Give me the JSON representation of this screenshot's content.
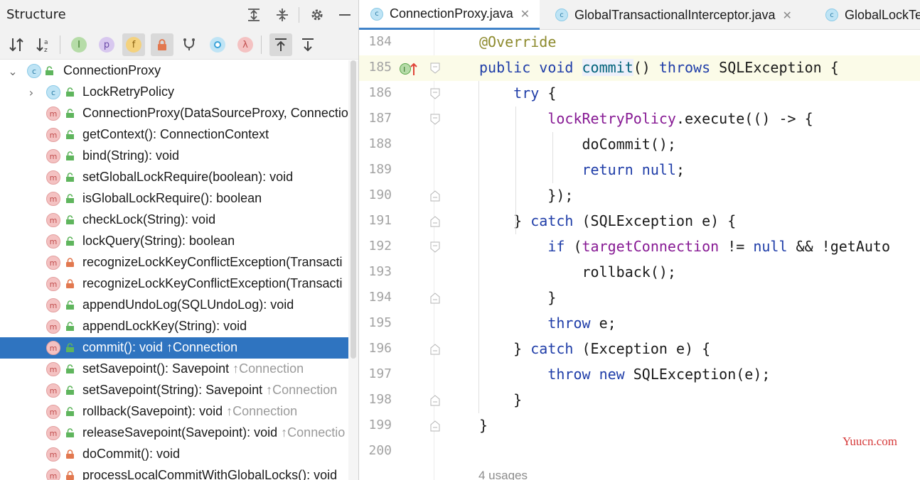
{
  "structure": {
    "title": "Structure",
    "header_icons": [
      "expand-all-icon",
      "collapse-all-icon",
      "gear-icon",
      "minimize-icon"
    ],
    "toolbar": [
      "sort-by-visibility-icon",
      "sort-alphabetically-icon",
      "show-inherited-icon",
      "show-properties-icon",
      "show-fields-icon",
      "show-non-public-icon",
      "show-anonymous-icon",
      "show-lambdas-icon",
      "show-lambda-icon",
      "autoscroll-to-source-icon",
      "autoscroll-from-source-icon"
    ],
    "root": "ConnectionProxy",
    "items": [
      {
        "kind": "c",
        "vis": "public",
        "label": "LockRetryPolicy",
        "suffix": "",
        "expandable": true
      },
      {
        "kind": "m",
        "vis": "public",
        "label": "ConnectionProxy(DataSourceProxy, Connection",
        "suffix": ""
      },
      {
        "kind": "m",
        "vis": "public",
        "label": "getContext(): ConnectionContext",
        "suffix": ""
      },
      {
        "kind": "m",
        "vis": "public",
        "label": "bind(String): void",
        "suffix": ""
      },
      {
        "kind": "m",
        "vis": "public",
        "label": "setGlobalLockRequire(boolean): void",
        "suffix": ""
      },
      {
        "kind": "m",
        "vis": "public",
        "label": "isGlobalLockRequire(): boolean",
        "suffix": ""
      },
      {
        "kind": "m",
        "vis": "public",
        "label": "checkLock(String): void",
        "suffix": ""
      },
      {
        "kind": "m",
        "vis": "public",
        "label": "lockQuery(String): boolean",
        "suffix": ""
      },
      {
        "kind": "m",
        "vis": "private",
        "label": "recognizeLockKeyConflictException(Transacti",
        "suffix": ""
      },
      {
        "kind": "m",
        "vis": "private",
        "label": "recognizeLockKeyConflictException(Transacti",
        "suffix": ""
      },
      {
        "kind": "m",
        "vis": "public",
        "label": "appendUndoLog(SQLUndoLog): void",
        "suffix": ""
      },
      {
        "kind": "m",
        "vis": "public",
        "label": "appendLockKey(String): void",
        "suffix": ""
      },
      {
        "kind": "m",
        "vis": "public",
        "label": "commit(): void ",
        "suffix": "↑Connection",
        "selected": true
      },
      {
        "kind": "m",
        "vis": "public",
        "label": "setSavepoint(): Savepoint ",
        "suffix": "↑Connection"
      },
      {
        "kind": "m",
        "vis": "public",
        "label": "setSavepoint(String): Savepoint ",
        "suffix": "↑Connection"
      },
      {
        "kind": "m",
        "vis": "public",
        "label": "rollback(Savepoint): void ",
        "suffix": "↑Connection"
      },
      {
        "kind": "m",
        "vis": "public",
        "label": "releaseSavepoint(Savepoint): void ",
        "suffix": "↑Connectio"
      },
      {
        "kind": "m",
        "vis": "private",
        "label": "doCommit(): void",
        "suffix": ""
      },
      {
        "kind": "m",
        "vis": "private",
        "label": "processLocalCommitWithGlobalLocks(): void",
        "suffix": ""
      }
    ]
  },
  "editor": {
    "tabs": [
      {
        "label": "ConnectionProxy.java",
        "active": true,
        "closable": true
      },
      {
        "label": "GlobalTransactionalInterceptor.java",
        "active": false,
        "closable": true
      },
      {
        "label": "GlobalLockTe",
        "active": false,
        "closable": false
      }
    ],
    "lines": [
      {
        "n": "184",
        "html": "<span class=\"ann\">@Override</span>"
      },
      {
        "n": "185",
        "current": true,
        "marker": true,
        "html": "<span class=\"kw\">public void</span> <span class=\"mdef\">commit</span>() <span class=\"kw\">throws</span> SQLException {"
      },
      {
        "n": "186",
        "html": "    <span class=\"kw\">try</span> {"
      },
      {
        "n": "187",
        "html": "        <span class=\"fld\">lockRetryPolicy</span>.execute(() -> {"
      },
      {
        "n": "188",
        "html": "            doCommit();"
      },
      {
        "n": "189",
        "html": "            <span class=\"kw\">return null</span>;"
      },
      {
        "n": "190",
        "html": "        });"
      },
      {
        "n": "191",
        "html": "    } <span class=\"kw\">catch</span> (SQLException e) {"
      },
      {
        "n": "192",
        "html": "        <span class=\"kw\">if</span> (<span class=\"fld\">targetConnection</span> != <span class=\"kw\">null</span> && !getAuto"
      },
      {
        "n": "193",
        "html": "            rollback();"
      },
      {
        "n": "194",
        "html": "        }"
      },
      {
        "n": "195",
        "html": "        <span class=\"kw\">throw</span> e;"
      },
      {
        "n": "196",
        "html": "    } <span class=\"kw\">catch</span> (Exception e) {"
      },
      {
        "n": "197",
        "html": "        <span class=\"kw\">throw new</span> SQLException(e);"
      },
      {
        "n": "198",
        "html": "    }"
      },
      {
        "n": "199",
        "html": "}"
      },
      {
        "n": "200",
        "html": ""
      }
    ],
    "fold_open_lines": [
      "185",
      "186",
      "187",
      "192"
    ],
    "fold_close_lines": [
      "190",
      "191",
      "194",
      "196",
      "198",
      "199"
    ],
    "usages": "4 usages",
    "watermark": "Yuucn.com"
  }
}
